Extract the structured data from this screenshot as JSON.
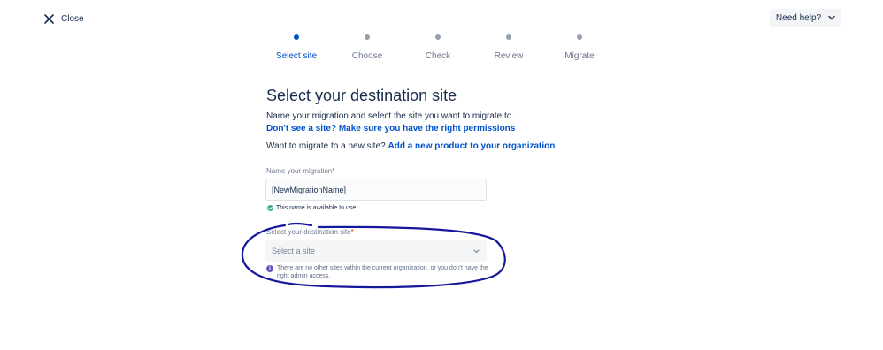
{
  "header": {
    "close_label": "Close",
    "help_label": "Need help?"
  },
  "steps": [
    {
      "label": "Select site",
      "active": true
    },
    {
      "label": "Choose",
      "active": false
    },
    {
      "label": "Check",
      "active": false
    },
    {
      "label": "Review",
      "active": false
    },
    {
      "label": "Migrate",
      "active": false
    }
  ],
  "main": {
    "title": "Select your destination site",
    "intro_text": "Name your migration and select the site you want to migrate to.",
    "permissions_link": "Don't see a site? Make sure you have the right permissions",
    "new_site_text": "Want to migrate to a new site?",
    "add_product_link": "Add a new product to your organization"
  },
  "migration_name": {
    "label": "Name your migration",
    "required_mark": "*",
    "value": "[NewMigrationName]",
    "status_text": "This name is available to use."
  },
  "destination_site": {
    "label": "Select your destination site",
    "required_mark": "*",
    "placeholder": "Select a site",
    "info_icon_text": "i",
    "info_text": "There are no other sites within the current organization, or you don't have the right admin access."
  },
  "icons": {
    "close": "close-icon",
    "help_chevron": "chevron-down-icon",
    "select_chevron": "chevron-down-icon",
    "success": "check-circle-icon",
    "info": "info-icon"
  },
  "colors": {
    "accent": "#0052cc",
    "text": "#172b4d",
    "muted": "#6b778c",
    "success": "#36b37e",
    "info": "#6554c0",
    "required": "#de350b",
    "annotation": "#16189a"
  }
}
